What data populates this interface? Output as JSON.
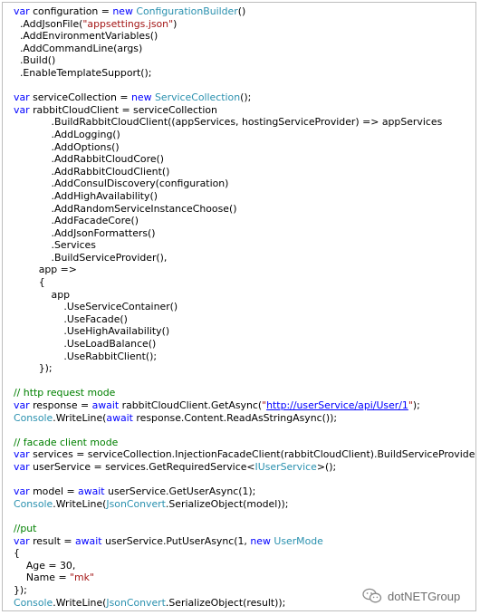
{
  "code": {
    "lines": [
      {
        "indent": 0,
        "segments": [
          {
            "t": "var",
            "c": "kw"
          },
          {
            "t": " configuration = "
          },
          {
            "t": "new",
            "c": "kw"
          },
          {
            "t": " "
          },
          {
            "t": "ConfigurationBuilder",
            "c": "ty"
          },
          {
            "t": "()"
          }
        ]
      },
      {
        "indent": 2,
        "segments": [
          {
            "t": ".AddJsonFile("
          },
          {
            "t": "\"appsettings.json\"",
            "c": "str"
          },
          {
            "t": ")"
          }
        ]
      },
      {
        "indent": 2,
        "segments": [
          {
            "t": ".AddEnvironmentVariables()"
          }
        ]
      },
      {
        "indent": 2,
        "segments": [
          {
            "t": ".AddCommandLine(args)"
          }
        ]
      },
      {
        "indent": 2,
        "segments": [
          {
            "t": ".Build()"
          }
        ]
      },
      {
        "indent": 2,
        "segments": [
          {
            "t": ".EnableTemplateSupport();"
          }
        ]
      },
      {
        "indent": 0,
        "segments": []
      },
      {
        "indent": 0,
        "segments": [
          {
            "t": "var",
            "c": "kw"
          },
          {
            "t": " serviceCollection = "
          },
          {
            "t": "new",
            "c": "kw"
          },
          {
            "t": " "
          },
          {
            "t": "ServiceCollection",
            "c": "ty"
          },
          {
            "t": "();"
          }
        ]
      },
      {
        "indent": 0,
        "segments": [
          {
            "t": "var",
            "c": "kw"
          },
          {
            "t": " rabbitCloudClient = serviceCollection"
          }
        ]
      },
      {
        "indent": 12,
        "segments": [
          {
            "t": ".BuildRabbitCloudClient((appServices, hostingServiceProvider) => appServices"
          }
        ]
      },
      {
        "indent": 12,
        "segments": [
          {
            "t": ".AddLogging()"
          }
        ]
      },
      {
        "indent": 12,
        "segments": [
          {
            "t": ".AddOptions()"
          }
        ]
      },
      {
        "indent": 12,
        "segments": [
          {
            "t": ".AddRabbitCloudCore()"
          }
        ]
      },
      {
        "indent": 12,
        "segments": [
          {
            "t": ".AddRabbitCloudClient()"
          }
        ]
      },
      {
        "indent": 12,
        "segments": [
          {
            "t": ".AddConsulDiscovery(configuration)"
          }
        ]
      },
      {
        "indent": 12,
        "segments": [
          {
            "t": ".AddHighAvailability()"
          }
        ]
      },
      {
        "indent": 12,
        "segments": [
          {
            "t": ".AddRandomServiceInstanceChoose()"
          }
        ]
      },
      {
        "indent": 12,
        "segments": [
          {
            "t": ".AddFacadeCore()"
          }
        ]
      },
      {
        "indent": 12,
        "segments": [
          {
            "t": ".AddJsonFormatters()"
          }
        ]
      },
      {
        "indent": 12,
        "segments": [
          {
            "t": ".Services"
          }
        ]
      },
      {
        "indent": 12,
        "segments": [
          {
            "t": ".BuildServiceProvider(),"
          }
        ]
      },
      {
        "indent": 8,
        "segments": [
          {
            "t": "app =>"
          }
        ]
      },
      {
        "indent": 8,
        "segments": [
          {
            "t": "{"
          }
        ]
      },
      {
        "indent": 12,
        "segments": [
          {
            "t": "app"
          }
        ]
      },
      {
        "indent": 16,
        "segments": [
          {
            "t": ".UseServiceContainer()"
          }
        ]
      },
      {
        "indent": 16,
        "segments": [
          {
            "t": ".UseFacade()"
          }
        ]
      },
      {
        "indent": 16,
        "segments": [
          {
            "t": ".UseHighAvailability()"
          }
        ]
      },
      {
        "indent": 16,
        "segments": [
          {
            "t": ".UseLoadBalance()"
          }
        ]
      },
      {
        "indent": 16,
        "segments": [
          {
            "t": ".UseRabbitClient();"
          }
        ]
      },
      {
        "indent": 8,
        "segments": [
          {
            "t": "});"
          }
        ]
      },
      {
        "indent": 0,
        "segments": []
      },
      {
        "indent": 0,
        "segments": [
          {
            "t": "// http request mode",
            "c": "cm"
          }
        ]
      },
      {
        "indent": 0,
        "segments": [
          {
            "t": "var",
            "c": "kw"
          },
          {
            "t": " response = "
          },
          {
            "t": "await",
            "c": "kw"
          },
          {
            "t": " rabbitCloudClient.GetAsync("
          },
          {
            "t": "\"",
            "c": "str"
          },
          {
            "t": "http://userService/api/User/1",
            "c": "url"
          },
          {
            "t": "\"",
            "c": "str"
          },
          {
            "t": ");"
          }
        ]
      },
      {
        "indent": 0,
        "segments": [
          {
            "t": "Console",
            "c": "ty"
          },
          {
            "t": ".WriteLine("
          },
          {
            "t": "await",
            "c": "kw"
          },
          {
            "t": " response.Content.ReadAsStringAsync());"
          }
        ]
      },
      {
        "indent": 0,
        "segments": []
      },
      {
        "indent": 0,
        "segments": [
          {
            "t": "// facade client mode",
            "c": "cm"
          }
        ]
      },
      {
        "indent": 0,
        "segments": [
          {
            "t": "var",
            "c": "kw"
          },
          {
            "t": " services = serviceCollection.InjectionFacadeClient(rabbitCloudClient).BuildServiceProvider();"
          }
        ]
      },
      {
        "indent": 0,
        "segments": [
          {
            "t": "var",
            "c": "kw"
          },
          {
            "t": " userService = services.GetRequiredService<"
          },
          {
            "t": "IUserService",
            "c": "ty"
          },
          {
            "t": ">();"
          }
        ]
      },
      {
        "indent": 0,
        "segments": []
      },
      {
        "indent": 0,
        "segments": [
          {
            "t": "var",
            "c": "kw"
          },
          {
            "t": " model = "
          },
          {
            "t": "await",
            "c": "kw"
          },
          {
            "t": " userService.GetUserAsync(1);"
          }
        ]
      },
      {
        "indent": 0,
        "segments": [
          {
            "t": "Console",
            "c": "ty"
          },
          {
            "t": ".WriteLine("
          },
          {
            "t": "JsonConvert",
            "c": "ty"
          },
          {
            "t": ".SerializeObject(model));"
          }
        ]
      },
      {
        "indent": 0,
        "segments": []
      },
      {
        "indent": 0,
        "segments": [
          {
            "t": "//put",
            "c": "cm"
          }
        ]
      },
      {
        "indent": 0,
        "segments": [
          {
            "t": "var",
            "c": "kw"
          },
          {
            "t": " result = "
          },
          {
            "t": "await",
            "c": "kw"
          },
          {
            "t": " userService.PutUserAsync(1, "
          },
          {
            "t": "new",
            "c": "kw"
          },
          {
            "t": " "
          },
          {
            "t": "UserMode",
            "c": "ty"
          }
        ]
      },
      {
        "indent": 0,
        "segments": [
          {
            "t": "{"
          }
        ]
      },
      {
        "indent": 4,
        "segments": [
          {
            "t": "Age = 30,"
          }
        ]
      },
      {
        "indent": 4,
        "segments": [
          {
            "t": "Name = "
          },
          {
            "t": "\"mk\"",
            "c": "str"
          }
        ]
      },
      {
        "indent": 0,
        "segments": [
          {
            "t": "});"
          }
        ]
      },
      {
        "indent": 0,
        "segments": [
          {
            "t": "Console",
            "c": "ty"
          },
          {
            "t": ".WriteLine("
          },
          {
            "t": "JsonConvert",
            "c": "ty"
          },
          {
            "t": ".SerializeObject(result));"
          }
        ]
      }
    ]
  },
  "watermark": {
    "text": "dotNETGroup",
    "icon": "wechat-icon"
  },
  "colors": {
    "keyword": "#0000ff",
    "type": "#2b91af",
    "string": "#a31515",
    "comment": "#008000",
    "text": "#000000"
  }
}
